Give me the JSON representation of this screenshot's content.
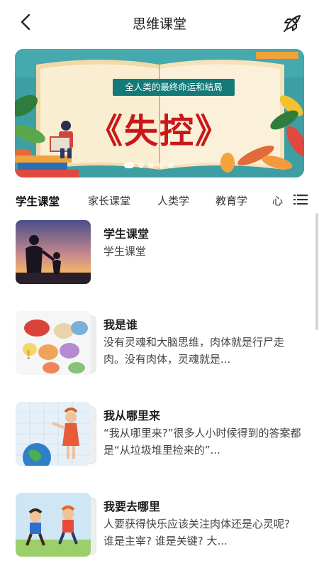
{
  "header": {
    "title": "思维课堂"
  },
  "banner": {
    "subtitle": "全人类的最终命运和结局",
    "main_title": "《失控》",
    "page_count": 5,
    "active_index": 0
  },
  "tabs": [
    {
      "label": "学生课堂",
      "active": true
    },
    {
      "label": "家长课堂",
      "active": false
    },
    {
      "label": "人类学",
      "active": false
    },
    {
      "label": "教育学",
      "active": false
    },
    {
      "label": "心",
      "active": false
    }
  ],
  "list": [
    {
      "title": "学生课堂",
      "desc": "学生课堂",
      "thumb_icon": "silhouette-sunset-thumbnail"
    },
    {
      "title": "我是谁",
      "desc": "没有灵魂和大脑思维，肉体就是行尸走肉。没有肉体，灵魂就是...",
      "thumb_icon": "speech-bubbles-thumbnail"
    },
    {
      "title": "我从哪里来",
      "desc": "“我从哪里来?”很多人小时候得到的答案都是“从垃圾堆里捡来的”...",
      "thumb_icon": "globe-girl-thumbnail"
    },
    {
      "title": "我要去哪里",
      "desc": "人要获得快乐应该关注肉体还是心灵呢? 谁是主宰? 谁是关键? 大...",
      "thumb_icon": "kids-running-thumbnail"
    }
  ],
  "colors": {
    "banner_bg": "#3d9fa4",
    "banner_title": "#c8181a",
    "subtitle_bg": "#137a78"
  }
}
